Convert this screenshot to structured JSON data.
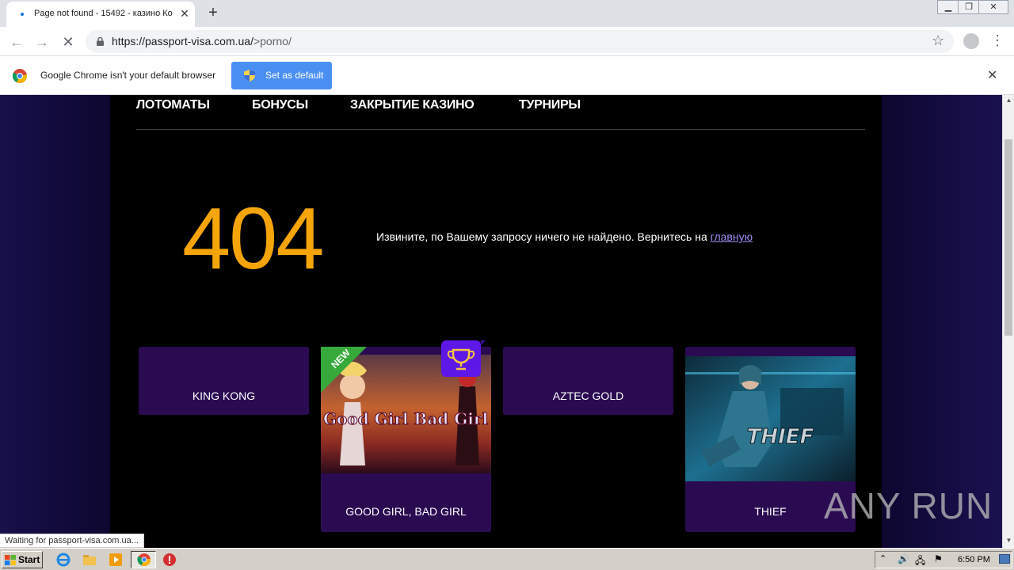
{
  "browser": {
    "tab_title": "Page not found - 15492 - казино Ко",
    "url_prefix": "https://passport-visa.com.ua/",
    "url_path": ">porno/",
    "infobar_message": "Google Chrome isn't your default browser",
    "set_default_label": "Set as default",
    "status_text": "Waiting for passport-visa.com.ua..."
  },
  "site": {
    "nav": [
      "ЛОТОМАТЫ",
      "БОНУСЫ",
      "ЗАКРЫТИЕ КАЗИНО",
      "ТУРНИРЫ"
    ],
    "error_code": "404",
    "error_message": "Извините, по Вашему запросу ничего не найдено. Вернитесь на",
    "home_link": "главную",
    "games": [
      {
        "name": "KING KONG"
      },
      {
        "name": "GOOD GIRL, BAD GIRL",
        "badge": "NEW",
        "trophy": true
      },
      {
        "name": "AZTEC GOLD"
      },
      {
        "name": "THIEF",
        "thumb_text": "THIEF"
      }
    ],
    "thumb_logo_text": "Good Girl Bad Girl"
  },
  "watermark": "ANY RUN",
  "taskbar": {
    "start_label": "Start",
    "clock": "6:50 PM"
  },
  "colors": {
    "accent_404": "#f5a50a",
    "card_bg": "#2a0b52",
    "link": "#9a8bf0",
    "set_default_btn": "#4b8ff3"
  }
}
